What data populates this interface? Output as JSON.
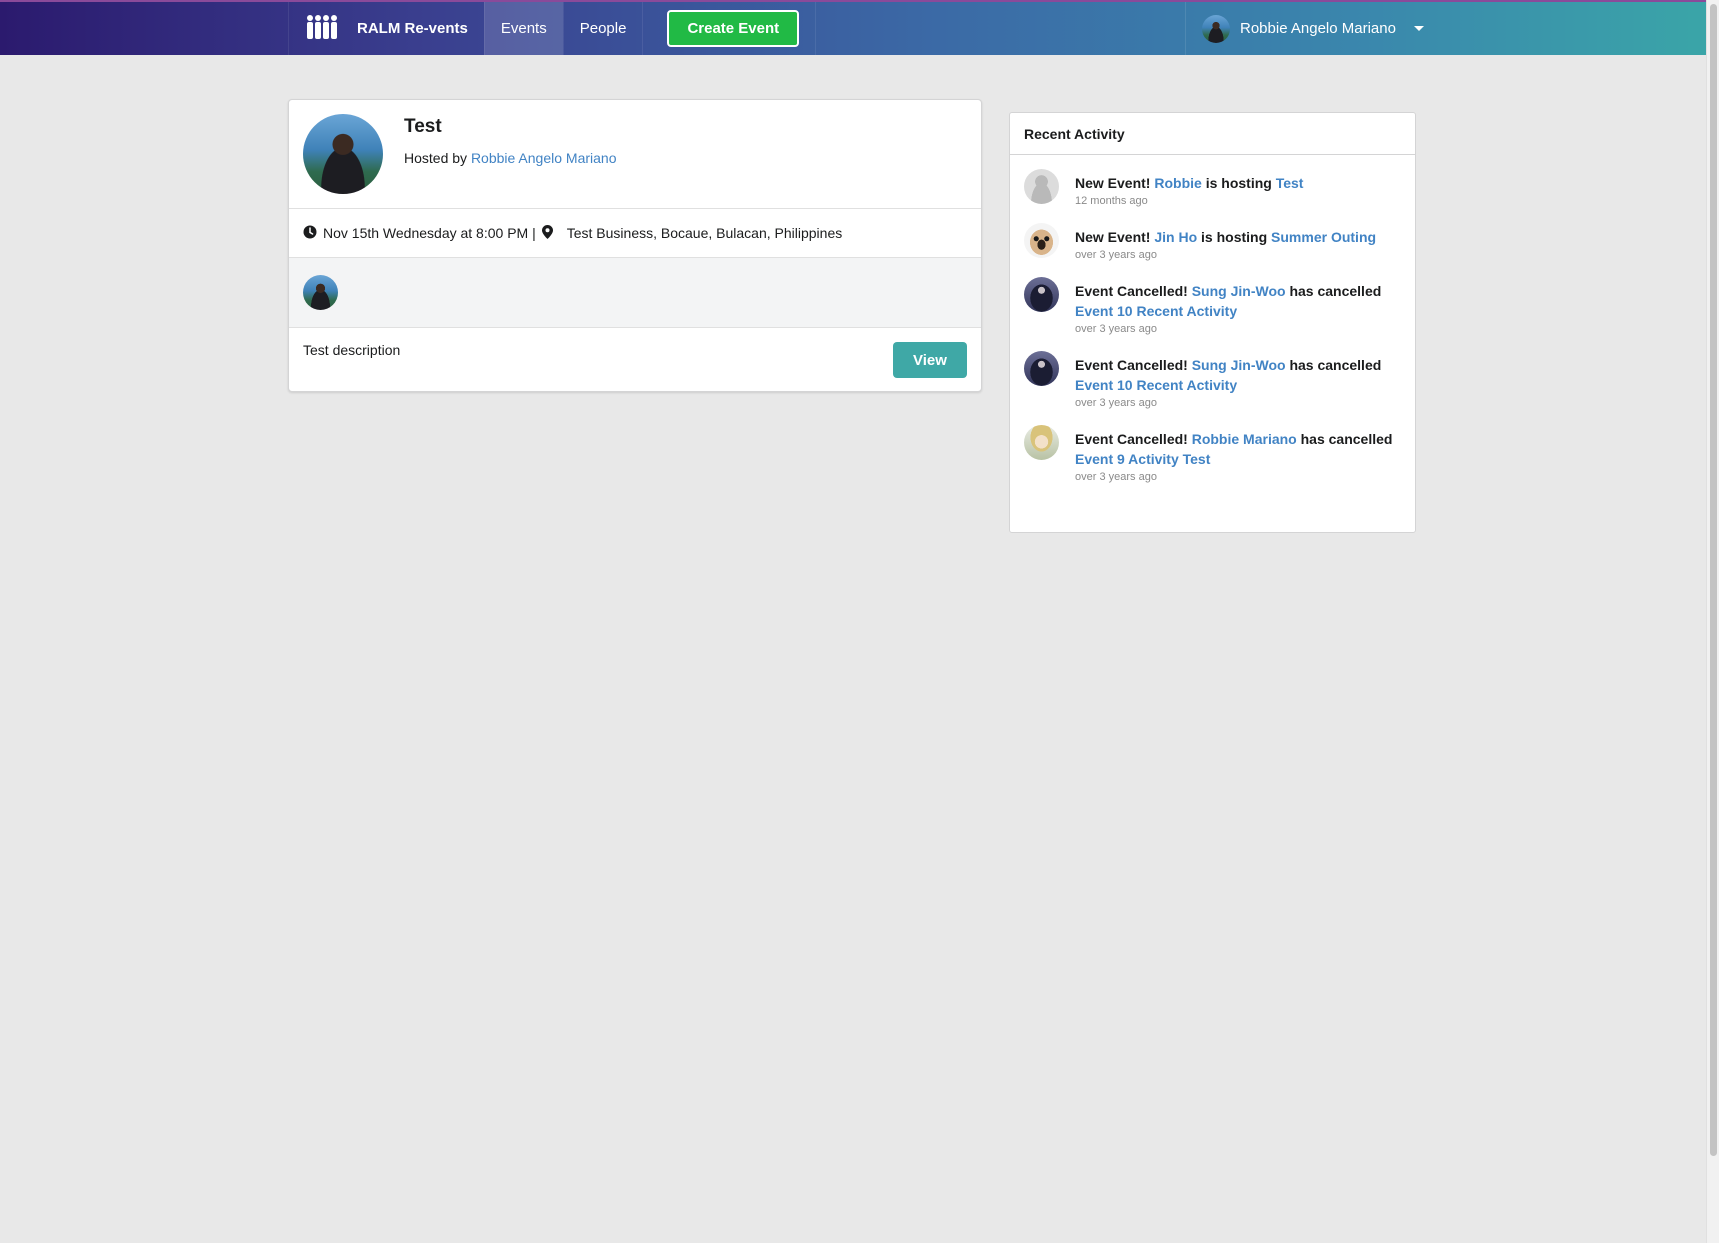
{
  "nav": {
    "brand": "RALM Re-vents",
    "events": "Events",
    "people": "People",
    "create_event": "Create Event",
    "user_name": "Robbie Angelo Mariano"
  },
  "event": {
    "title": "Test",
    "hosted_prefix": "Hosted by",
    "host": "Robbie Angelo Mariano",
    "datetime": "Nov 15th Wednesday at 8:00 PM |",
    "venue": "Test Business, Bocaue, Bulacan, Philippines",
    "description": "Test description",
    "view_button": "View"
  },
  "activity": {
    "header": "Recent Activity",
    "items": [
      {
        "avatar": "grey",
        "type": "New Event!",
        "user": "Robbie",
        "verb": "is hosting",
        "event": "Test",
        "time": "12 months ago"
      },
      {
        "avatar": "pug",
        "type": "New Event!",
        "user": "Jin Ho",
        "verb": "is hosting",
        "event": "Summer Outing",
        "time": "over 3 years ago"
      },
      {
        "avatar": "dark",
        "type": "Event Cancelled!",
        "user": "Sung Jin-Woo",
        "verb": "has cancelled",
        "event": "Event 10 Recent Activity",
        "time": "over 3 years ago"
      },
      {
        "avatar": "dark",
        "type": "Event Cancelled!",
        "user": "Sung Jin-Woo",
        "verb": "has cancelled",
        "event": "Event 10 Recent Activity",
        "time": "over 3 years ago"
      },
      {
        "avatar": "anime",
        "type": "Event Cancelled!",
        "user": "Robbie Mariano",
        "verb": "has cancelled",
        "event": "Event 9 Activity Test",
        "time": "over 3 years ago"
      }
    ]
  },
  "colors": {
    "link": "#4183c4",
    "create_button": "#21ba45",
    "view_button": "#3fa8a6"
  }
}
